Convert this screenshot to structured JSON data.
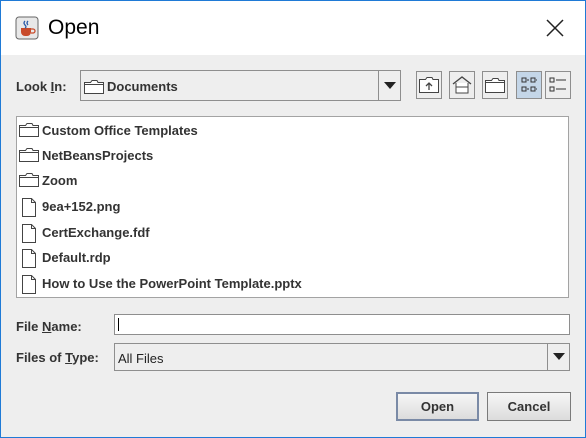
{
  "window": {
    "title": "Open",
    "app_icon": "java-cup-icon",
    "close_icon": "close-icon"
  },
  "lookin": {
    "label_prefix": "Look ",
    "label_mnemonic": "I",
    "label_suffix": "n:",
    "value": "Documents",
    "folder_icon": "folder-icon"
  },
  "toolbar": [
    {
      "name": "up-one-level-button",
      "icon": "up-folder-icon"
    },
    {
      "name": "home-button",
      "icon": "home-icon"
    },
    {
      "name": "new-folder-button",
      "icon": "new-folder-icon"
    },
    {
      "name": "list-view-button",
      "icon": "list-view-icon",
      "active": true
    },
    {
      "name": "details-view-button",
      "icon": "details-view-icon"
    }
  ],
  "files": [
    {
      "label": "Custom Office Templates",
      "type": "folder"
    },
    {
      "label": "NetBeansProjects",
      "type": "folder"
    },
    {
      "label": "Zoom",
      "type": "folder"
    },
    {
      "label": "9ea+152.png",
      "type": "file"
    },
    {
      "label": "CertExchange.fdf",
      "type": "file"
    },
    {
      "label": "Default.rdp",
      "type": "file"
    },
    {
      "label": "How to Use the PowerPoint Template.pptx",
      "type": "file"
    }
  ],
  "filename": {
    "label_prefix": "File ",
    "label_mnemonic": "N",
    "label_suffix": "ame:",
    "value": ""
  },
  "filetype": {
    "label_prefix": "Files of ",
    "label_mnemonic": "T",
    "label_suffix": "ype:",
    "value": "All Files"
  },
  "buttons": {
    "open": "Open",
    "cancel": "Cancel"
  }
}
